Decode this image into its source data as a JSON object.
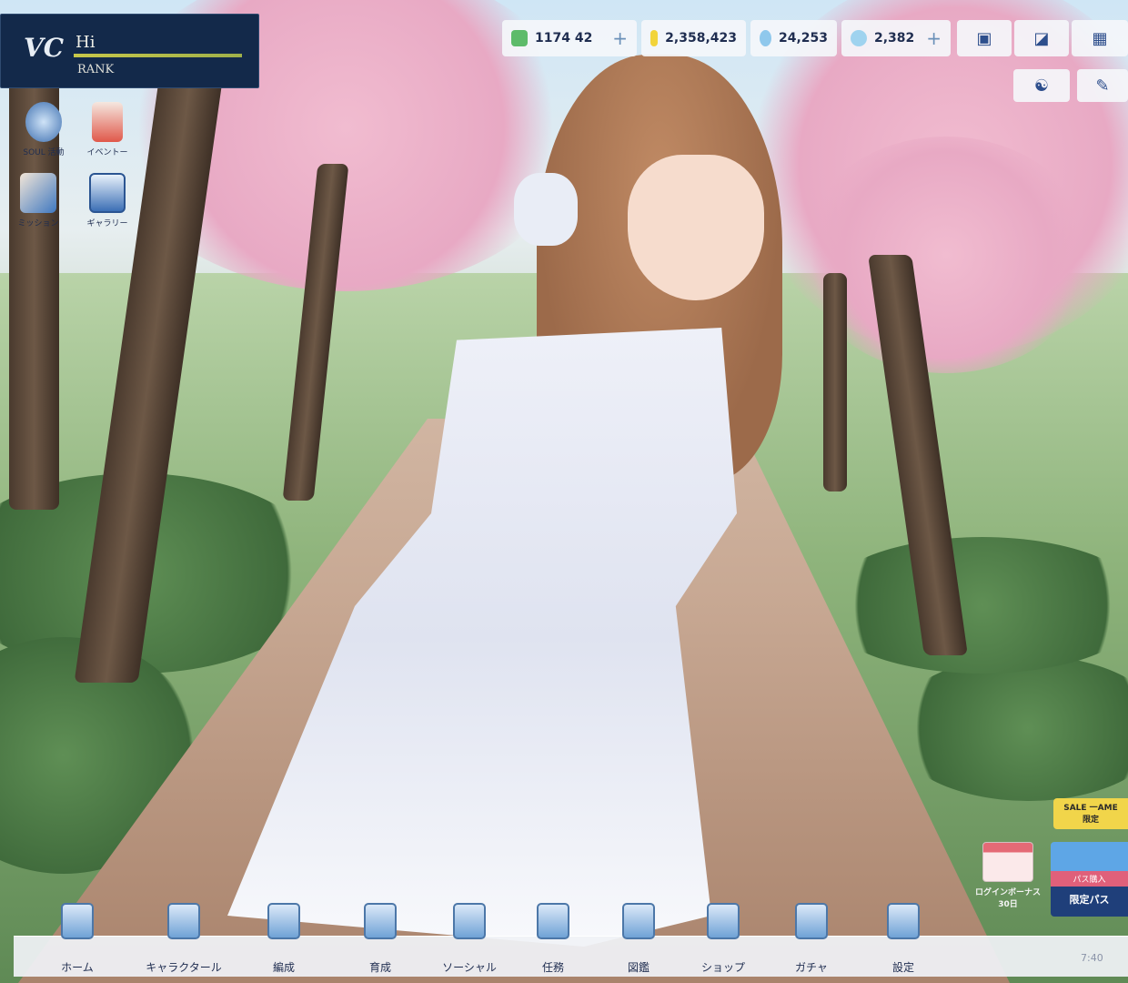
{
  "profile": {
    "logo": "VC",
    "name": "Hi",
    "rank_label": "RANK"
  },
  "currencies": [
    {
      "icon": "stamina-icon",
      "value": "1174 42",
      "has_plus": true
    },
    {
      "icon": "gold-coin-icon",
      "value": "2,358,423",
      "has_plus": false
    },
    {
      "icon": "gem-icon",
      "value": "24,253",
      "has_plus": false
    },
    {
      "icon": "crystal-icon",
      "value": "2,382",
      "has_plus": true
    }
  ],
  "top_buttons": [
    "mail-icon",
    "gift-icon",
    "menu-grid-icon"
  ],
  "second_row_buttons": [
    "friend-icon",
    "edit-icon"
  ],
  "desktop_icons": [
    {
      "icon": "announcement-icon",
      "label": "SOUL 活動"
    },
    {
      "icon": "event-icon",
      "label": "イベントー"
    },
    {
      "icon": "mission-icon",
      "label": "ミッション"
    },
    {
      "icon": "album-icon",
      "label": "ギャラリー"
    }
  ],
  "nav": [
    {
      "icon": "home-icon",
      "label": "ホーム"
    },
    {
      "icon": "character-icon",
      "label": "キャラクタール"
    },
    {
      "icon": "formation-icon",
      "label": "編成"
    },
    {
      "icon": "training-icon",
      "label": "育成"
    },
    {
      "icon": "social-icon",
      "label": "ソーシャル"
    },
    {
      "icon": "quest-icon",
      "label": "任務"
    },
    {
      "icon": "archive-icon",
      "label": "図鑑"
    },
    {
      "icon": "shop-icon",
      "label": "ショップ"
    },
    {
      "icon": "gacha-icon",
      "label": "ガチャ"
    },
    {
      "icon": "settings-icon",
      "label": "設定"
    }
  ],
  "clock": "7:40",
  "event_banner": {
    "title": "SALE 一AME",
    "subtitle": "限定"
  },
  "calendar": {
    "label": "ログインボーナス",
    "sub": "30日"
  },
  "pass_card": {
    "label": "パス購入",
    "sub": "限定パス"
  }
}
